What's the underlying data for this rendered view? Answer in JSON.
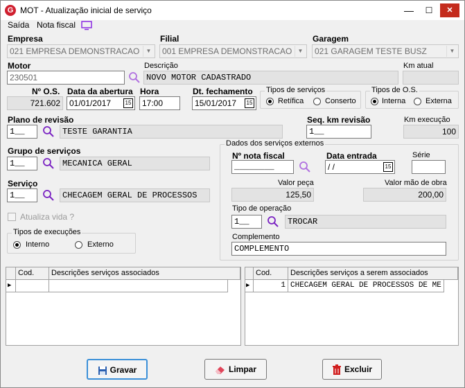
{
  "window": {
    "title": "MOT - Atualização inicial de serviço",
    "minimize": "—",
    "maximize": "☐",
    "close": "✕"
  },
  "menu": {
    "saida": "Saída",
    "nota_fiscal": "Nota fiscal"
  },
  "empresa": {
    "label": "Empresa",
    "value": "021 EMPRESA DEMONSTRACAO"
  },
  "filial": {
    "label": "Filial",
    "value": "001 EMPRESA DEMONSTRACAO"
  },
  "garagem": {
    "label": "Garagem",
    "value": "021 GARAGEM TESTE BUSZ"
  },
  "motor": {
    "label": "Motor",
    "value": "230501",
    "desc_label": "Descrição",
    "desc_value": "NOVO MOTOR CADASTRADO",
    "km_label": "Km atual",
    "km_value": ""
  },
  "os": {
    "label": "Nº O.S.",
    "value": "721.602"
  },
  "abertura": {
    "label": "Data da abertura",
    "value": "01/01/2017"
  },
  "hora": {
    "label": "Hora",
    "value": "17:00"
  },
  "fechamento": {
    "label": "Dt. fechamento",
    "value": "15/01/2017"
  },
  "tipos_servicos": {
    "title": "Tipos de serviços",
    "opt1": "Retífica",
    "opt2": "Conserto"
  },
  "tipos_os": {
    "title": "Tipos de O.S.",
    "opt1": "Interna",
    "opt2": "Externa"
  },
  "plano": {
    "label": "Plano de revisão",
    "code": "1__",
    "value": "TESTE GARANTIA"
  },
  "seq_km": {
    "label": "Seq. km revisão",
    "value": "1__"
  },
  "km_execucao": {
    "label": "Km execução",
    "value": "100"
  },
  "grupo": {
    "label": "Grupo de serviços",
    "code": "1__",
    "value": "MECANICA GERAL"
  },
  "servico": {
    "label": "Serviço",
    "code": "1__",
    "value": "CHECAGEM GERAL DE PROCESSOS"
  },
  "atualiza_vida": {
    "label": "Atualiza vida ?"
  },
  "tipos_exec": {
    "title": "Tipos de execuções",
    "opt1": "Interno",
    "opt2": "Externo"
  },
  "externos": {
    "title": "Dados dos serviços externos",
    "nota_label": "Nº nota fiscal",
    "nota_value": "________",
    "entrada_label": "Data entrada",
    "entrada_value": " / /",
    "serie_label": "Série",
    "serie_value": "",
    "valor_peca_label": "Valor peça",
    "valor_peca_value": "125,50",
    "valor_mao_label": "Valor mão de obra",
    "valor_mao_value": "200,00",
    "tipo_op_label": "Tipo de operação",
    "tipo_op_code": "1__",
    "tipo_op_value": "TROCAR",
    "complemento_label": "Complemento",
    "complemento_value": "COMPLEMENTO"
  },
  "grid_left": {
    "col_cod": "Cod.",
    "col_desc": "Descrições serviços associados",
    "rows": [
      {
        "cod": "",
        "desc": ""
      }
    ]
  },
  "grid_right": {
    "col_cod": "Cod.",
    "col_desc": "Descrições serviços a serem associados",
    "rows": [
      {
        "cod": "1",
        "desc": "CHECAGEM GERAL DE PROCESSOS DE ME"
      }
    ]
  },
  "buttons": {
    "gravar": "Gravar",
    "limpar": "Limpar",
    "excluir": "Excluir"
  }
}
